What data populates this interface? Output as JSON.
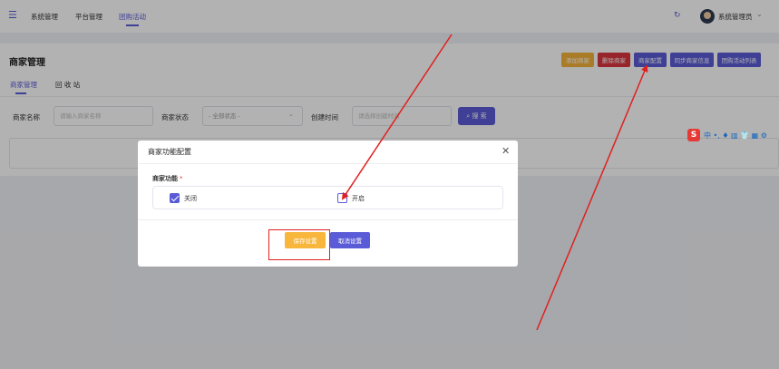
{
  "topbar": {
    "nav": [
      "系统管理",
      "平台管理",
      "团购活动"
    ],
    "active_nav": "团购活动",
    "user_name": "系统管理员"
  },
  "page": {
    "title": "商家管理",
    "actions": [
      {
        "label": "添加商家",
        "color": "#f5b23a"
      },
      {
        "label": "删除商家",
        "color": "#d9363e"
      },
      {
        "label": "商家配置",
        "color": "#5a5bd6"
      },
      {
        "label": "同步商家信息",
        "color": "#5a5bd6"
      },
      {
        "label": "团购活动列表",
        "color": "#5a5bd6"
      }
    ],
    "tabs": [
      "商家管理",
      "回 收 站"
    ],
    "filters": {
      "name_label": "商家名称",
      "name_placeholder": "请输入商家名称",
      "status_label": "商家状态",
      "status_value": "- 全部状态 -",
      "time_label": "创建时间",
      "time_placeholder": "请选择创建时间",
      "search_label": "搜 索"
    }
  },
  "ime": {
    "logo": "S",
    "items": "中 •, ♦ ▥ 👕 ▦ ⚙"
  },
  "modal": {
    "title": "商家功能配置",
    "field_label": "商家功能",
    "required_mark": "*",
    "options": [
      {
        "label": "关闭",
        "checked": true
      },
      {
        "label": "开启",
        "checked": false
      }
    ],
    "save_label": "保存设置",
    "cancel_label": "取消设置"
  },
  "colors": {
    "accent": "#5a5bd6",
    "annotation": "#e02020"
  }
}
